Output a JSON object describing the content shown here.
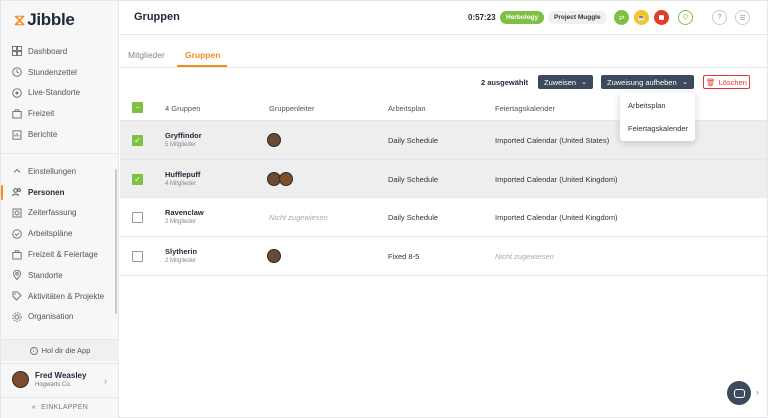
{
  "brand": {
    "logo_mark": "⧖",
    "name": "Jibble",
    "accent": "#f58a1f"
  },
  "sidebar": {
    "items": [
      {
        "label": "Dashboard",
        "icon": "dashboard-icon"
      },
      {
        "label": "Stundenzettel",
        "icon": "clock-icon"
      },
      {
        "label": "Live-Standorte",
        "icon": "location-icon"
      },
      {
        "label": "Freizeit",
        "icon": "suitcase-icon"
      },
      {
        "label": "Berichte",
        "icon": "report-icon"
      }
    ],
    "settings_header": "Einstellungen",
    "settings_items": [
      {
        "label": "Personen",
        "icon": "people-icon",
        "active": true
      },
      {
        "label": "Zeiterfassung",
        "icon": "time-tracking-icon"
      },
      {
        "label": "Arbeitspläne",
        "icon": "schedule-icon"
      },
      {
        "label": "Freizeit & Feiertage",
        "icon": "holiday-icon"
      },
      {
        "label": "Standorte",
        "icon": "pin-icon"
      },
      {
        "label": "Aktivitäten & Projekte",
        "icon": "tag-icon"
      },
      {
        "label": "Organisation",
        "icon": "gear-icon"
      },
      {
        "label": "Integrationen",
        "icon": "integration-icon"
      }
    ],
    "get_app": "Hol dir die App",
    "user": {
      "name": "Fred Weasley",
      "org": "Hogwarts Co."
    },
    "collapse": "EINKLAPPEN"
  },
  "header": {
    "title": "Gruppen",
    "timer": "0:57:23",
    "activity_chip": "Herbology",
    "project_chip": "Project Muggle"
  },
  "tabs": [
    {
      "label": "Mitglieder",
      "active": false
    },
    {
      "label": "Gruppen",
      "active": true
    }
  ],
  "toolbar": {
    "selected_count": "2 ausgewählt",
    "assign": "Zuweisen",
    "unassign": "Zuweisung aufheben",
    "delete": "Löschen"
  },
  "dropdown": [
    "Arbeitsplan",
    "Feiertagskalender"
  ],
  "table": {
    "headers": [
      "4 Gruppen",
      "Gruppenleiter",
      "Arbeitsplan",
      "Feiertagskalender"
    ],
    "rows": [
      {
        "name": "Gryffindor",
        "members": "5 Mitglieder",
        "leaders": 1,
        "schedule": "Daily Schedule",
        "calendar": "Imported Calendar (United States)",
        "selected": true
      },
      {
        "name": "Hufflepuff",
        "members": "4 Mitglieder",
        "leaders": 2,
        "schedule": "Daily Schedule",
        "calendar": "Imported Calendar (United Kingdom)",
        "selected": true
      },
      {
        "name": "Ravenclaw",
        "members": "2 Mitglieder",
        "leaders": 0,
        "leader_placeholder": "Nicht zugewiesen",
        "schedule": "Daily Schedule",
        "calendar": "Imported Calendar (United Kingdom)",
        "selected": false
      },
      {
        "name": "Slytherin",
        "members": "2 Mitglieder",
        "leaders": 1,
        "schedule": "Fixed 8-5",
        "calendar": "",
        "calendar_placeholder": "Nicht zugewiesen",
        "selected": false
      }
    ]
  }
}
